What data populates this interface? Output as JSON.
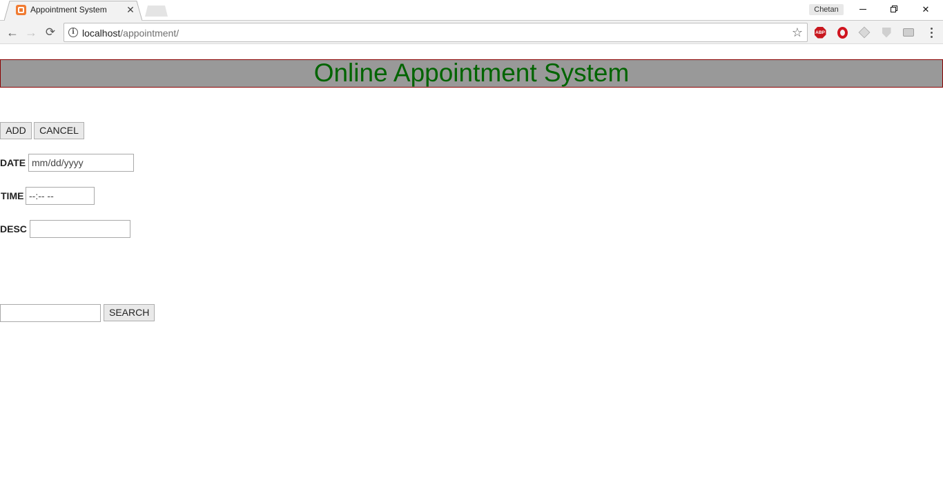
{
  "browser": {
    "tab": {
      "title": "Appointment System",
      "close": "✕"
    },
    "profile": "Chetan",
    "window": {
      "close": "✕"
    },
    "nav": {
      "back": "←",
      "forward": "→",
      "reload": "⟳"
    },
    "url": {
      "host": "localhost",
      "path": "/appointment/"
    },
    "icons": {
      "bookmark": "☆",
      "info": "i",
      "abp": "ABP"
    }
  },
  "page": {
    "heading": "Online Appointment System",
    "buttons": {
      "add": "ADD",
      "cancel": "CANCEL",
      "search": "SEARCH"
    },
    "labels": {
      "date": "DATE",
      "time": "TIME",
      "desc": "DESC"
    },
    "fields": {
      "date_placeholder": "mm/dd/yyyy",
      "time_placeholder": "--:-- --",
      "desc_value": "",
      "search_value": ""
    },
    "colors": {
      "heading_text": "#006400",
      "heading_bg": "#999999",
      "heading_border": "#8b0000"
    }
  }
}
